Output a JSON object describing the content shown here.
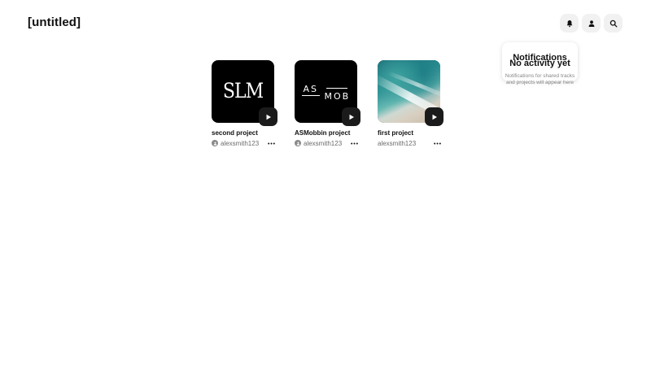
{
  "app": {
    "title": "[untitled]"
  },
  "toolbar": {
    "buttons": [
      {
        "name": "notifications-button",
        "icon": "bell-icon"
      },
      {
        "name": "profile-button",
        "icon": "user-icon"
      },
      {
        "name": "search-button",
        "icon": "search-icon"
      }
    ]
  },
  "notifications": {
    "title": "Notifications",
    "empty_title": "No activity yet",
    "empty_description": "Notifications for shared tracks and projects will appear here"
  },
  "projects": [
    {
      "title": "second project",
      "owner": "alexsmith123",
      "owner_icon": true,
      "thumb": "slm-logo",
      "thumb_text": "SLM"
    },
    {
      "title": "ASMobbin project",
      "owner": "alexsmith123",
      "owner_icon": true,
      "thumb": "asmob-logo",
      "thumb_text_a": "AS",
      "thumb_text_b": "MOB"
    },
    {
      "title": "first project",
      "owner": "alexsmith123",
      "owner_icon": false,
      "thumb": "beach-photo"
    }
  ],
  "colors": {
    "background": "#ffffff",
    "button_bg": "#f1f1f1",
    "play_bg": "#1b1b1b",
    "text": "#111111",
    "muted": "#6b6b6b"
  }
}
